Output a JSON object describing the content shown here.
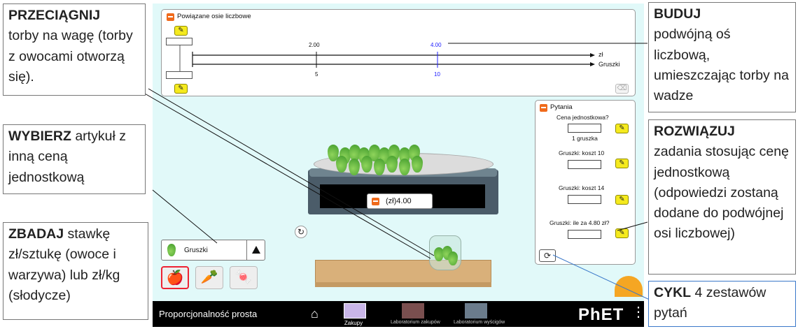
{
  "number_line": {
    "title": "Powiązane osie liczbowe",
    "tick_top_1": "2.00",
    "tick_top_2": "4.00",
    "tick_bottom_1": "5",
    "tick_bottom_2": "10",
    "axis_top_label": "zł",
    "axis_bottom_label": "Gruszki"
  },
  "questions": {
    "title": "Pytania",
    "q1_label": "Cena jednostkowa?",
    "q1_unit": "1 gruszka",
    "q2_label": "Gruszki: koszt 10",
    "q3_label": "Gruszki: koszt 14",
    "q4_label": "Gruszki: ile za 4.80 zł?"
  },
  "scale": {
    "price": "(zł)4.00"
  },
  "fruit_selector": {
    "selected": "Gruszki",
    "items": [
      {
        "name": "apple",
        "glyph": "🍎"
      },
      {
        "name": "carrot",
        "glyph": "🥕"
      },
      {
        "name": "candy",
        "glyph": "🍬"
      }
    ]
  },
  "navbar": {
    "title": "Proporcjonalność prosta",
    "tabs": [
      {
        "label": "Zakupy",
        "active": true
      },
      {
        "label": "Laboratorium zakupów",
        "active": false
      },
      {
        "label": "Laboratorium wyścigów",
        "active": false
      }
    ],
    "logo": "PhET"
  },
  "callouts": {
    "drag_bold": "PRZECIĄGNIJ",
    "drag_text": "torby na wagę (torby z owocami otworzą się).",
    "choose_bold": "WYBIERZ",
    "choose_text": " artykuł z inną ceną jednostkową",
    "explore_bold": "ZBADAJ",
    "explore_text": " stawkę zł/sztukę (owoce i warzywa) lub zł/kg (słodycze)",
    "build_bold": "BUDUJ",
    "build_text": "podwójną oś liczbową, umieszczając torby na wadze",
    "solve_bold": "ROZWIĄZUJ",
    "solve_text": "zadania stosując cenę jednostkową (odpowiedzi zostaną dodane do podwójnej osi liczbowej)",
    "cycle_bold": "CYKL",
    "cycle_text": " 4 zestawów pytań"
  },
  "colors": {
    "sim_bg": "#e1f9f9",
    "accent_orange": "#f06a1b",
    "edit_yellow": "#f5ea1e",
    "blue_marker": "#2020ff"
  }
}
